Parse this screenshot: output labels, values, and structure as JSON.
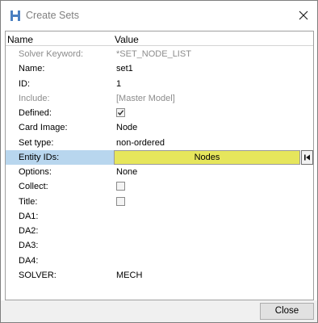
{
  "window": {
    "title": "Create Sets",
    "close_glyph": "×",
    "icon": "hypermesh-h-icon"
  },
  "table": {
    "header_name": "Name",
    "header_value": "Value",
    "rows": [
      {
        "label": "Solver Keyword:",
        "value": "*SET_NODE_LIST",
        "greyed": true
      },
      {
        "label": "Name:",
        "value": "set1"
      },
      {
        "label": "ID:",
        "value": "1"
      },
      {
        "label": "Include:",
        "value": "[Master Model]",
        "greyed": true
      },
      {
        "label": "Defined:",
        "checkbox": true,
        "checked": true
      },
      {
        "label": "Card Image:",
        "value": "Node"
      },
      {
        "label": "Set type:",
        "value": "non-ordered"
      },
      {
        "label": "Entity IDs:",
        "value": "Nodes",
        "selected": true,
        "button_color": "#e6e65c"
      },
      {
        "label": "Options:",
        "value": "None"
      },
      {
        "label": "Collect:",
        "checkbox": true,
        "checked": false
      },
      {
        "label": "Title:",
        "checkbox": true,
        "checked": false
      },
      {
        "label": "DA1:",
        "value": ""
      },
      {
        "label": "DA2:",
        "value": ""
      },
      {
        "label": "DA3:",
        "value": ""
      },
      {
        "label": "DA4:",
        "value": ""
      },
      {
        "label": "SOLVER:",
        "value": "MECH"
      }
    ]
  },
  "footer": {
    "close_label": "Close"
  },
  "colors": {
    "selected_row": "#b8d6ee",
    "entity_button": "#e6e65c",
    "greyed_text": "#8c8c8c"
  }
}
